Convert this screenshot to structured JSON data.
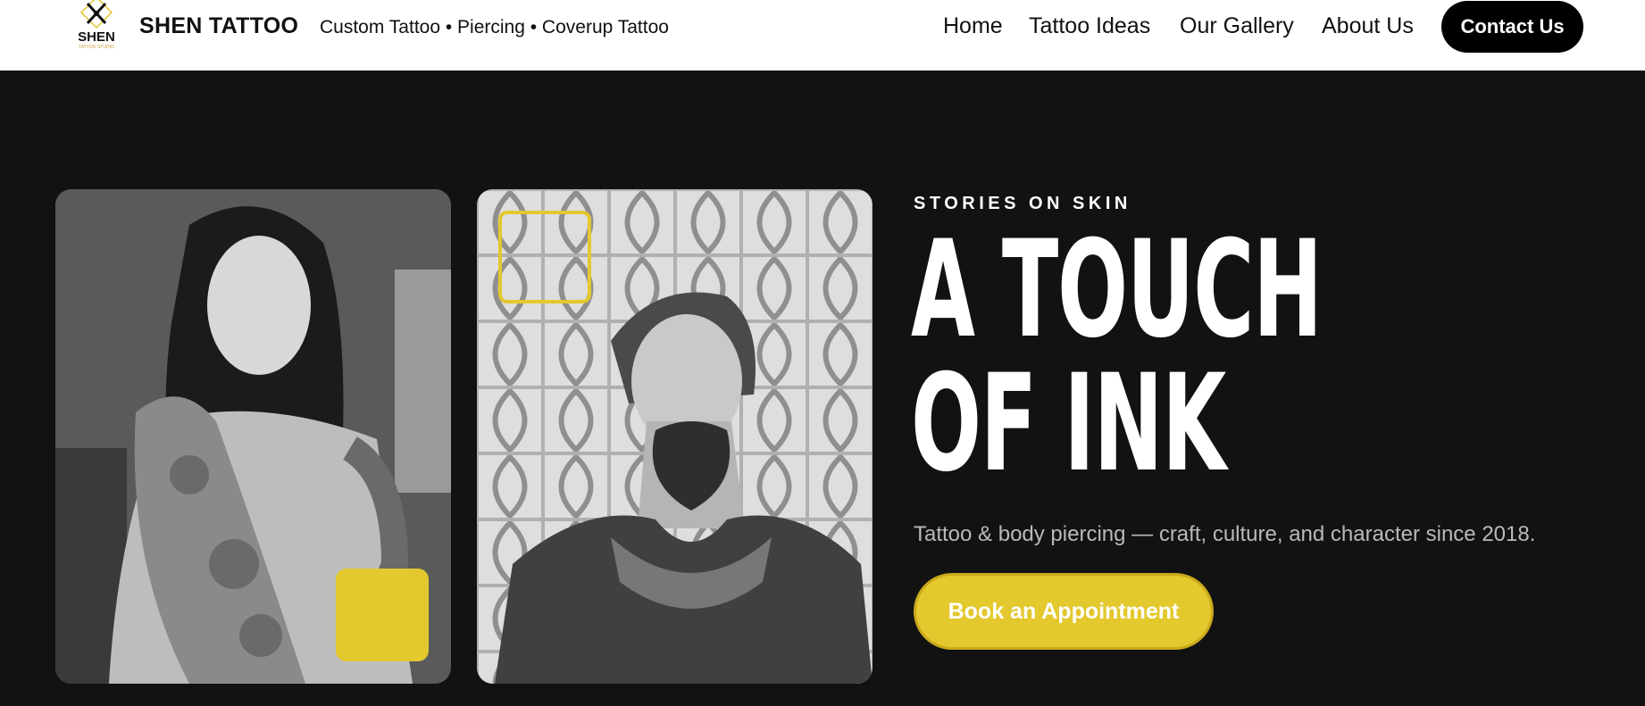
{
  "header": {
    "logo": {
      "name": "SHEN",
      "sub": "TATTOO STUDIO",
      "icon": "crossed-tattoo-machines-icon"
    },
    "brand": "SHEN TATTOO",
    "tagline": "Custom Tattoo • Piercing • Coverup Tattoo",
    "nav": [
      {
        "label": "Home"
      },
      {
        "label": "Tattoo Ideas"
      },
      {
        "label": "Our Gallery"
      },
      {
        "label": "About Us"
      }
    ],
    "contact_label": "Contact Us"
  },
  "hero": {
    "eyebrow": "STORIES ON SKIN",
    "headline": [
      "A TOUCH",
      "OF INK"
    ],
    "subtitle": "Tattoo & body piercing — craft, culture, and character since 2018.",
    "cta_label": "Book an Appointment"
  },
  "colors": {
    "background": "#121212",
    "accent": "#e3c82e",
    "header_bg": "#ffffff",
    "text_muted": "#b9b9b9"
  }
}
